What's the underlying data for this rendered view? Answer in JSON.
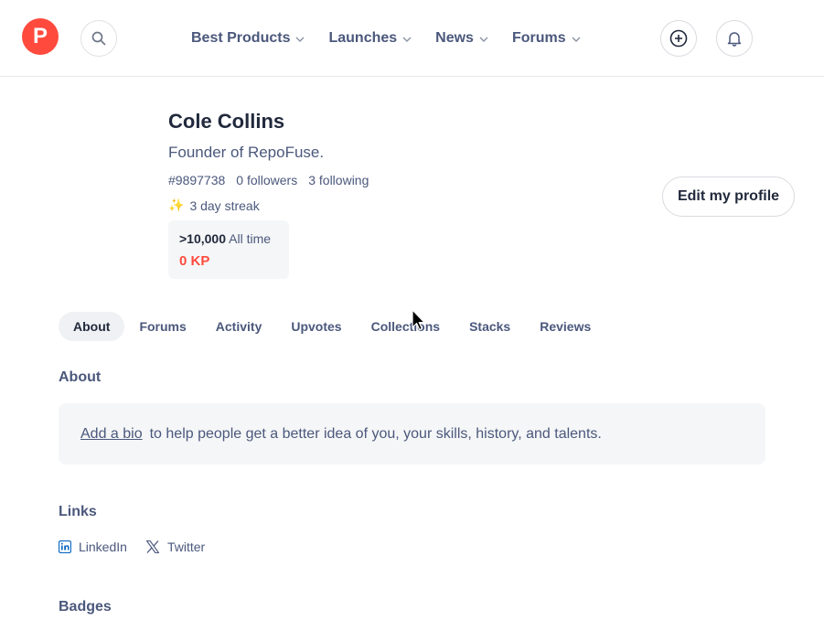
{
  "header": {
    "logo_letter": "P",
    "nav": [
      {
        "label": "Best Products"
      },
      {
        "label": "Launches"
      },
      {
        "label": "News"
      },
      {
        "label": "Forums"
      }
    ],
    "icons": [
      "search-icon",
      "plus-circle-icon",
      "bell-icon"
    ]
  },
  "profile": {
    "name": "Cole Collins",
    "headline": "Founder of RepoFuse.",
    "user_id": "#9897738",
    "followers": "0 followers",
    "following": "3 following",
    "streak_emoji": "✨",
    "streak": "3 day streak",
    "kp_rank": ">10,000",
    "kp_rank_label": "All time",
    "kp_value": "0 KP",
    "edit_label": "Edit my profile"
  },
  "tabs": [
    {
      "label": "About",
      "active": true
    },
    {
      "label": "Forums"
    },
    {
      "label": "Activity"
    },
    {
      "label": "Upvotes"
    },
    {
      "label": "Collections"
    },
    {
      "label": "Stacks"
    },
    {
      "label": "Reviews"
    }
  ],
  "about": {
    "title": "About",
    "bio_link": "Add a bio",
    "bio_text": "to help people get a better idea of you, your skills, history, and talents."
  },
  "links": {
    "title": "Links",
    "items": [
      {
        "label": "LinkedIn",
        "icon": "linkedin-icon"
      },
      {
        "label": "Twitter",
        "icon": "x-twitter-icon"
      }
    ]
  },
  "badges": {
    "title": "Badges"
  },
  "colors": {
    "brand": "#ff4a3d",
    "text": "#21293c",
    "muted": "#4b587c"
  }
}
